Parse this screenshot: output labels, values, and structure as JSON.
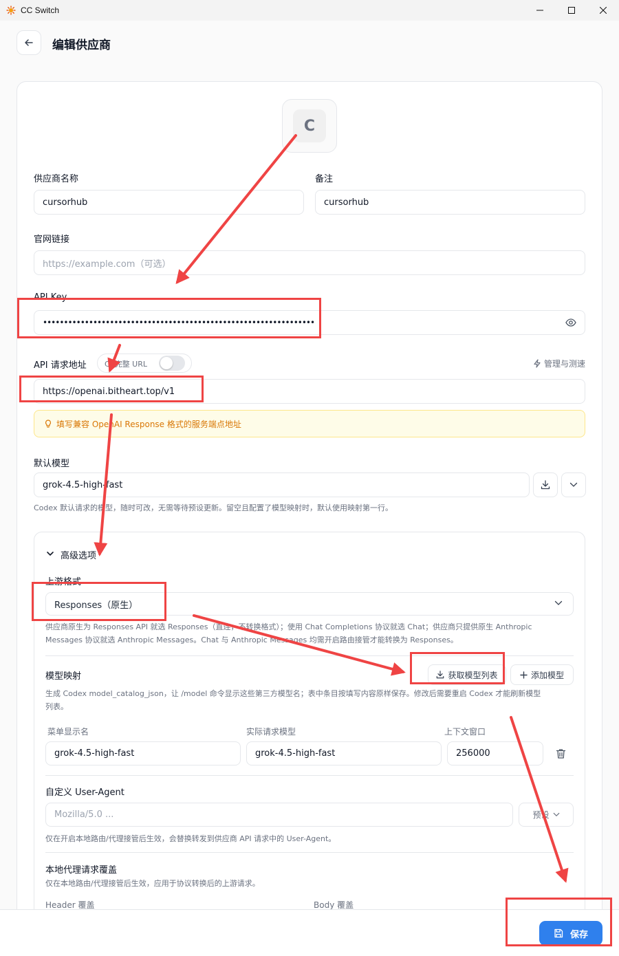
{
  "window": {
    "title": "CC Switch"
  },
  "header": {
    "title": "编辑供应商"
  },
  "avatar": {
    "letter": "C"
  },
  "form": {
    "provider_name": {
      "label": "供应商名称",
      "value": "cursorhub"
    },
    "remark": {
      "label": "备注",
      "value": "cursorhub"
    },
    "website": {
      "label": "官网链接",
      "placeholder": "https://example.com（可选）"
    },
    "api_key": {
      "label": "API Key",
      "value": "•••••••••••••••••••••••••••••••••••••••••••••••••••••••••••••••••"
    },
    "api_url": {
      "label": "API 请求地址",
      "toggle_label": "完整 URL",
      "toggle_prefix": "C",
      "toggle_on": false,
      "manage_label": "管理与测速",
      "value": "https://openai.bitheart.top/v1",
      "notice": "填写兼容 OpenAI Response 格式的服务端点地址"
    },
    "default_model": {
      "label": "默认模型",
      "value": "grok-4.5-high-fast",
      "hint": "Codex 默认请求的模型，随时可改，无需等待预设更新。留空且配置了模型映射时，默认使用映射第一行。"
    }
  },
  "advanced": {
    "title": "高级选项",
    "upstream": {
      "label": "上游格式",
      "value": "Responses（原生）",
      "hint_line1": "供应商原生为 Responses API 就选 Responses（直连，不转换格式）；使用 Chat Completions 协议就选 Chat；供应商只提供原生 Anthropic",
      "hint_line2": "Messages 协议就选 Anthropic Messages。Chat 与 Anthropic Messages 均需开启路由接管才能转换为 Responses。"
    },
    "model_mapping": {
      "label": "模型映射",
      "fetch_button": "获取模型列表",
      "add_button": "添加模型",
      "hint_line1": "生成 Codex model_catalog_json，让 /model 命令显示这些第三方模型名；表中条目按填写内容原样保存。修改后需要重启 Codex 才能刷新模型",
      "hint_line2": "列表。",
      "columns": [
        "菜单显示名",
        "实际请求模型",
        "上下文窗口"
      ],
      "rows": [
        {
          "display": "grok-4.5-high-fast",
          "model": "grok-4.5-high-fast",
          "context": "256000"
        }
      ]
    },
    "user_agent": {
      "label": "自定义 User-Agent",
      "placeholder": "Mozilla/5.0 ...",
      "preset_label": "预设",
      "hint": "仅在开启本地路由/代理接管后生效，会替换转发到供应商 API 请求中的 User-Agent。"
    },
    "override": {
      "label": "本地代理请求覆盖",
      "hint": "仅在本地路由/代理接管后生效，应用于协议转换后的上游请求。",
      "header_label": "Header 覆盖",
      "body_label": "Body 覆盖"
    }
  },
  "footer": {
    "save_label": "保存"
  },
  "colors": {
    "accent": "#2f80ed",
    "annotation": "#ef4444",
    "notice_text": "#d97706"
  }
}
